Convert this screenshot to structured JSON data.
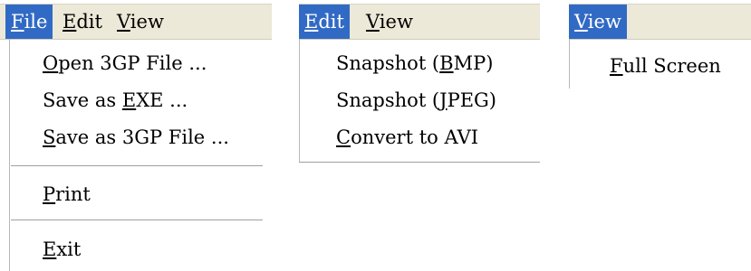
{
  "panel1": {
    "menubar": [
      {
        "pre": "",
        "acc": "F",
        "post": "ile",
        "active": true
      },
      {
        "pre": "",
        "acc": "E",
        "post": "dit",
        "active": false
      },
      {
        "pre": "",
        "acc": "V",
        "post": "iew",
        "active": false
      }
    ],
    "items": [
      {
        "pre": "",
        "acc": "O",
        "post": "pen 3GP File ..."
      },
      {
        "pre": "Save as ",
        "acc": "E",
        "post": "XE ..."
      },
      {
        "pre": "",
        "acc": "S",
        "post": "ave as 3GP File ..."
      },
      {
        "pre": "",
        "acc": "P",
        "post": "rint"
      },
      {
        "pre": "",
        "acc": "E",
        "post": "xit"
      }
    ]
  },
  "panel2": {
    "menubar": [
      {
        "pre": "",
        "acc": "E",
        "post": "dit",
        "active": true
      },
      {
        "pre": "",
        "acc": "V",
        "post": "iew",
        "active": false
      }
    ],
    "items": [
      {
        "pre": "Snapshot (",
        "acc": "B",
        "post": "MP)"
      },
      {
        "pre": "Snapshot (",
        "acc": "J",
        "post": "PEG)"
      },
      {
        "pre": "",
        "acc": "C",
        "post": "onvert to AVI"
      }
    ]
  },
  "panel3": {
    "menubar": [
      {
        "pre": "",
        "acc": "V",
        "post": "iew",
        "active": true
      }
    ],
    "items": [
      {
        "pre": "",
        "acc": "F",
        "post": "ull Screen"
      }
    ]
  },
  "colors": {
    "menubar_bg": "#ece9d8",
    "highlight": "#316ac5",
    "highlight_text": "#ffffff"
  }
}
